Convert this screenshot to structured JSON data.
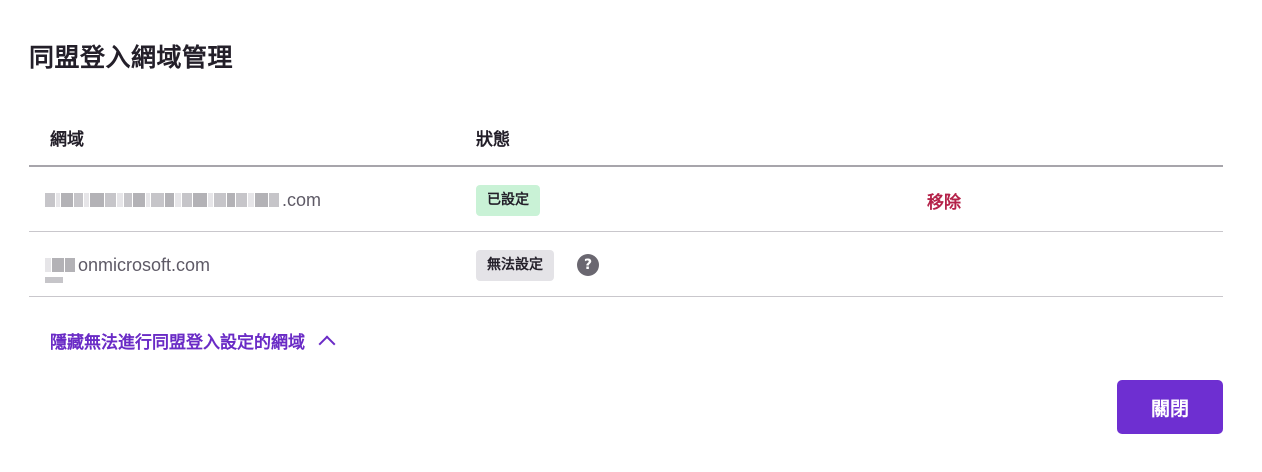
{
  "dialog": {
    "title": "同盟登入網域管理",
    "close_label": "關閉"
  },
  "table": {
    "headers": {
      "domain": "網域",
      "status": "狀態"
    },
    "rows": [
      {
        "domain_suffix": ".com",
        "status": "已設定",
        "action": "移除"
      },
      {
        "domain_suffix": "onmicrosoft.com",
        "status": "無法設定"
      }
    ]
  },
  "toggle": {
    "label": "隱藏無法進行同盟登入設定的網域"
  },
  "icons": {
    "help": "?"
  },
  "colors": {
    "accent": "#6e2fd1",
    "link": "#6a2bc6",
    "danger": "#b5234a",
    "badge_ok": "#c9f2d6",
    "badge_neutral": "#e4e3e7"
  }
}
